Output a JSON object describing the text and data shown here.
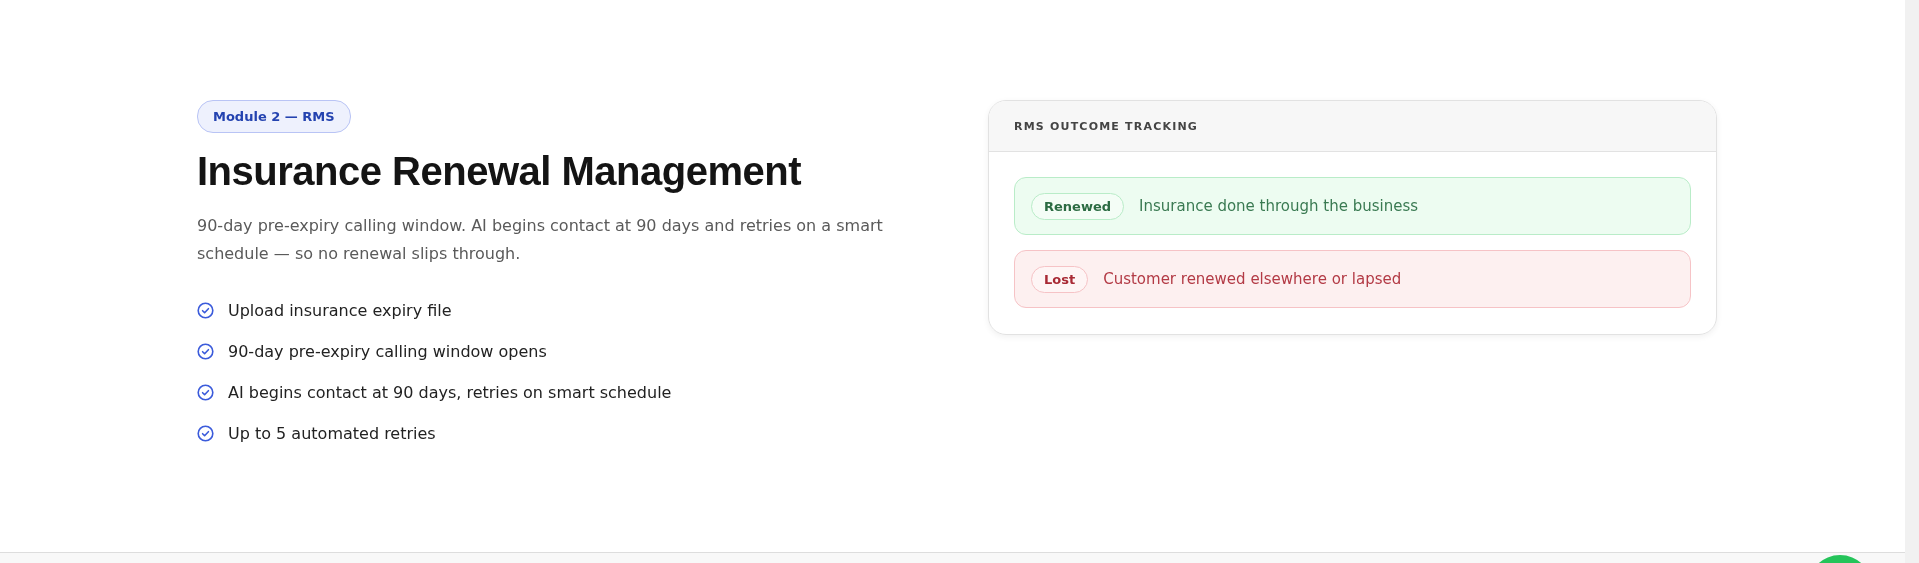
{
  "badge": "Module 2 — RMS",
  "title": "Insurance Renewal Management",
  "description": "90-day pre-expiry calling window. AI begins contact at 90 days and retries on a smart schedule — so no renewal slips through.",
  "steps": [
    "Upload insurance expiry file",
    "90-day pre-expiry calling window opens",
    "AI begins contact at 90 days, retries on smart schedule",
    "Up to 5 automated retries"
  ],
  "card": {
    "title": "RMS OUTCOME TRACKING",
    "outcomes": [
      {
        "kind": "renewed",
        "tag": "Renewed",
        "text": "Insurance done through the business"
      },
      {
        "kind": "lost",
        "tag": "Lost",
        "text": "Customer renewed elsewhere or lapsed"
      }
    ]
  }
}
